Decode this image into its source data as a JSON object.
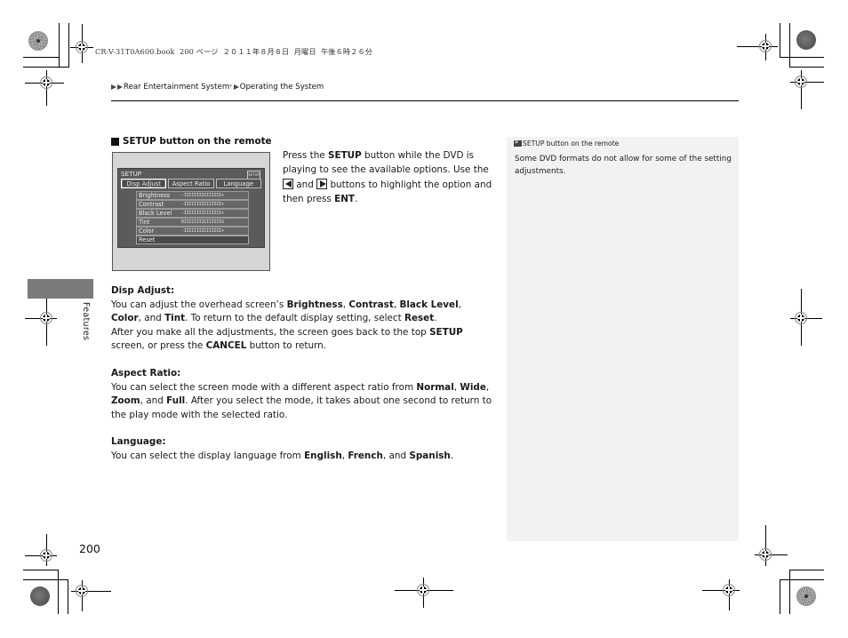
{
  "print_header": {
    "file_info": "CR-V-31T0A600.book  200 ページ  ２０１１年８月８日  月曜日  午後６時２６分"
  },
  "breadcrumb": {
    "items": [
      "Rear Entertainment System",
      "Operating the System"
    ],
    "asterisk": "*"
  },
  "side_tab": {
    "label": "Features"
  },
  "section": {
    "title": "SETUP button on the remote",
    "screen": {
      "title": "SETUP",
      "corner_icon": "SETUP",
      "tabs": [
        "Disp Adjust",
        "Aspect Ratio",
        "Language"
      ],
      "active_tab": "Disp Adjust",
      "rows": [
        {
          "label": "Brightness",
          "bar": "-IIIIIIIIIIIIIII+"
        },
        {
          "label": "Contrast",
          "bar": "-IIIIIIIIIIIIIII+"
        },
        {
          "label": "Black Level",
          "bar": "-IIIIIIIIIIIIIII+"
        },
        {
          "label": "Tint",
          "bar": "RIIIIIIIIIIIIIIIG"
        },
        {
          "label": "Color",
          "bar": "-IIIIIIIIIIIIIII+"
        },
        {
          "label": "Reset",
          "bar": ""
        }
      ]
    },
    "intro": {
      "t1": "Press the ",
      "b1": "SETUP",
      "t2": " button while the DVD is playing to see the available options. Use the ",
      "t3": " and ",
      "t4": " buttons to highlight the option and then press ",
      "b2": "ENT",
      "t5": "."
    }
  },
  "disp_adjust": {
    "heading": "Disp Adjust:",
    "p1": [
      {
        "t": "You can adjust the overhead screen’s "
      },
      {
        "b": "Brightness"
      },
      {
        "t": ", "
      },
      {
        "b": "Contrast"
      },
      {
        "t": ", "
      },
      {
        "b": "Black Level"
      },
      {
        "t": ", "
      },
      {
        "b": "Color"
      },
      {
        "t": ", and "
      },
      {
        "b": "Tint"
      },
      {
        "t": ". To return to the default display setting, select "
      },
      {
        "b": "Reset"
      },
      {
        "t": "."
      }
    ],
    "p2": [
      {
        "t": "After you make all the adjustments, the screen goes back to the top "
      },
      {
        "b": "SETUP"
      },
      {
        "t": " screen, or press the "
      },
      {
        "b": "CANCEL"
      },
      {
        "t": " button to return."
      }
    ]
  },
  "aspect_ratio": {
    "heading": "Aspect Ratio:",
    "p1": [
      {
        "t": "You can select the screen mode with a different aspect ratio from "
      },
      {
        "b": "Normal"
      },
      {
        "t": ", "
      },
      {
        "b": "Wide"
      },
      {
        "t": ", "
      },
      {
        "b": "Zoom"
      },
      {
        "t": ", and "
      },
      {
        "b": "Full"
      },
      {
        "t": ". After you select the mode, it takes about one second to return to the play mode with the selected ratio."
      }
    ]
  },
  "language": {
    "heading": "Language:",
    "p1": [
      {
        "t": "You can select the display language from "
      },
      {
        "b": "English"
      },
      {
        "t": ", "
      },
      {
        "b": "French"
      },
      {
        "t": ", and "
      },
      {
        "b": "Spanish"
      },
      {
        "t": "."
      }
    ]
  },
  "note": {
    "title": "SETUP button on the remote",
    "text": "Some DVD formats do not allow for some of the setting adjustments."
  },
  "page_number": "200"
}
